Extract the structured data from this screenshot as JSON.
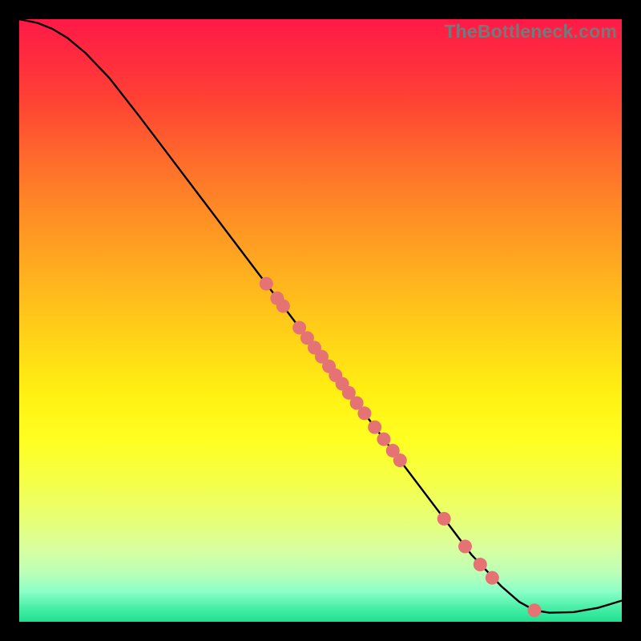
{
  "watermark": "TheBottleneck.com",
  "chart_data": {
    "type": "line",
    "title": "",
    "xlabel": "",
    "ylabel": "",
    "xlim": [
      0,
      100
    ],
    "ylim": [
      0,
      100
    ],
    "curve": [
      {
        "x": 0.0,
        "y": 100.0
      },
      {
        "x": 3.0,
        "y": 99.4
      },
      {
        "x": 5.5,
        "y": 98.4
      },
      {
        "x": 8.0,
        "y": 96.9
      },
      {
        "x": 11.0,
        "y": 94.4
      },
      {
        "x": 15.0,
        "y": 90.2
      },
      {
        "x": 20.0,
        "y": 83.8
      },
      {
        "x": 25.0,
        "y": 77.2
      },
      {
        "x": 30.0,
        "y": 70.6
      },
      {
        "x": 35.0,
        "y": 64.0
      },
      {
        "x": 40.0,
        "y": 57.4
      },
      {
        "x": 45.0,
        "y": 50.8
      },
      {
        "x": 50.0,
        "y": 44.2
      },
      {
        "x": 55.0,
        "y": 37.6
      },
      {
        "x": 60.0,
        "y": 31.0
      },
      {
        "x": 65.0,
        "y": 24.4
      },
      {
        "x": 70.0,
        "y": 17.8
      },
      {
        "x": 75.0,
        "y": 11.2
      },
      {
        "x": 80.0,
        "y": 5.9
      },
      {
        "x": 83.0,
        "y": 3.3
      },
      {
        "x": 85.5,
        "y": 1.9
      },
      {
        "x": 88.0,
        "y": 1.5
      },
      {
        "x": 92.0,
        "y": 1.6
      },
      {
        "x": 96.0,
        "y": 2.3
      },
      {
        "x": 100.0,
        "y": 3.5
      }
    ],
    "points": [
      {
        "x": 41.0,
        "y": 56.1
      },
      {
        "x": 42.8,
        "y": 53.7
      },
      {
        "x": 43.8,
        "y": 52.4
      },
      {
        "x": 46.5,
        "y": 48.8
      },
      {
        "x": 47.8,
        "y": 47.1
      },
      {
        "x": 49.0,
        "y": 45.5
      },
      {
        "x": 50.2,
        "y": 44.0
      },
      {
        "x": 51.4,
        "y": 42.4
      },
      {
        "x": 52.5,
        "y": 40.9
      },
      {
        "x": 53.6,
        "y": 39.5
      },
      {
        "x": 54.7,
        "y": 38.0
      },
      {
        "x": 56.0,
        "y": 36.3
      },
      {
        "x": 57.3,
        "y": 34.6
      },
      {
        "x": 59.0,
        "y": 32.3
      },
      {
        "x": 60.5,
        "y": 30.3
      },
      {
        "x": 62.0,
        "y": 28.4
      },
      {
        "x": 63.2,
        "y": 26.8
      },
      {
        "x": 70.5,
        "y": 17.1
      },
      {
        "x": 74.0,
        "y": 12.5
      },
      {
        "x": 76.5,
        "y": 9.5
      },
      {
        "x": 78.5,
        "y": 7.3
      },
      {
        "x": 85.5,
        "y": 1.9
      }
    ],
    "colors": {
      "curve": "#000000",
      "point_fill": "#e57373",
      "point_stroke": "#c05555"
    }
  }
}
